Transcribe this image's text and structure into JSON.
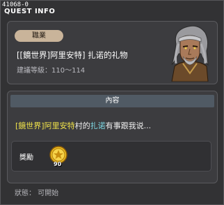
{
  "window": {
    "quest_id": "41068-0",
    "title": "QUEST INFO"
  },
  "quest": {
    "category_tag": "職業",
    "name": "[[鏡世界]阿里安特] 扎诺的礼物",
    "level": "建議等級：110～114",
    "portrait_icon": "old-man-npc-portrait"
  },
  "content": {
    "header": "內容",
    "description": {
      "part1": "[鏡世界]阿里安特",
      "part2": "村的",
      "part3": "扎诺",
      "part4": "有事跟我说..."
    }
  },
  "reward": {
    "label": "獎勵",
    "item_icon": "gold-coin-icon",
    "quantity": "90"
  },
  "status": {
    "text": "狀態： 可開始"
  },
  "colors": {
    "highlight_yellow": "#f0e24a",
    "highlight_cyan": "#7fdbe6",
    "tag_bg": "#c9b49a",
    "header_bg": "#505a64"
  }
}
